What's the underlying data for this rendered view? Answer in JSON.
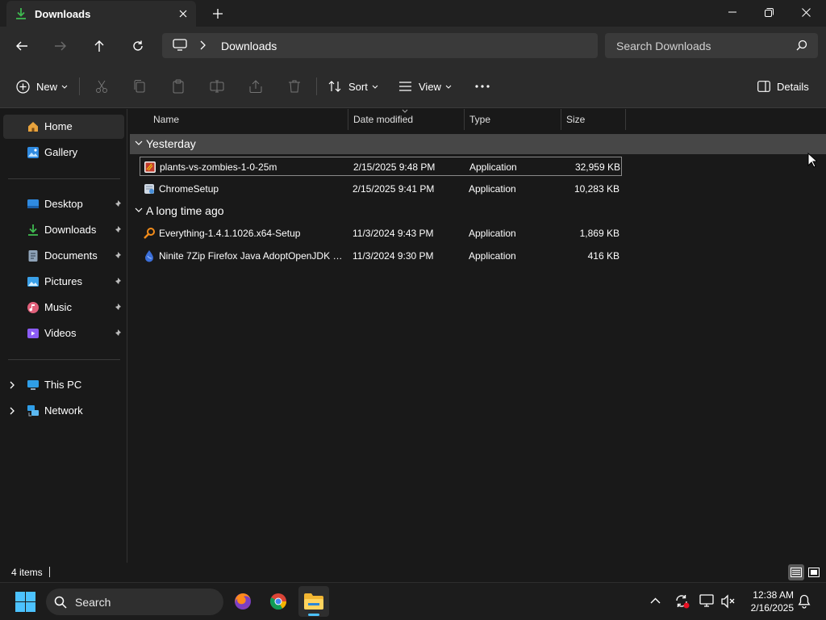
{
  "window": {
    "tab_title": "Downloads",
    "colors": {
      "titlebar": "#202020",
      "toolbar": "#2b2b2b",
      "content": "#191919",
      "accent": "#4cc2ff"
    }
  },
  "address": {
    "path": "Downloads",
    "search_placeholder": "Search Downloads"
  },
  "commands": {
    "new": "New",
    "sort": "Sort",
    "view": "View",
    "details": "Details"
  },
  "sidebar": {
    "home": "Home",
    "gallery": "Gallery",
    "pinned": [
      {
        "label": "Desktop",
        "icon": "desktop-icon"
      },
      {
        "label": "Downloads",
        "icon": "download-icon"
      },
      {
        "label": "Documents",
        "icon": "documents-icon"
      },
      {
        "label": "Pictures",
        "icon": "pictures-icon"
      },
      {
        "label": "Music",
        "icon": "music-icon"
      },
      {
        "label": "Videos",
        "icon": "videos-icon"
      }
    ],
    "this_pc": "This PC",
    "network": "Network"
  },
  "columns": {
    "name": "Name",
    "date": "Date modified",
    "type": "Type",
    "size": "Size"
  },
  "groups": [
    {
      "label": "Yesterday",
      "files": [
        {
          "name": "plants-vs-zombies-1-0-25m",
          "date": "2/15/2025 9:48 PM",
          "type": "Application",
          "size": "32,959 KB",
          "icon": "pvz-app-icon"
        },
        {
          "name": "ChromeSetup",
          "date": "2/15/2025 9:41 PM",
          "type": "Application",
          "size": "10,283 KB",
          "icon": "installer-icon"
        }
      ]
    },
    {
      "label": "A long time ago",
      "files": [
        {
          "name": "Everything-1.4.1.1026.x64-Setup",
          "date": "11/3/2024 9:43 PM",
          "type": "Application",
          "size": "1,869 KB",
          "icon": "magnifier-app-icon"
        },
        {
          "name": "Ninite 7Zip Firefox Java AdoptOpenJDK x...",
          "date": "11/3/2024 9:30 PM",
          "type": "Application",
          "size": "416 KB",
          "icon": "ninite-icon"
        }
      ]
    }
  ],
  "status": {
    "item_count": "4 items"
  },
  "taskbar": {
    "search_placeholder": "Search",
    "time": "12:38 AM",
    "date": "2/16/2025"
  }
}
